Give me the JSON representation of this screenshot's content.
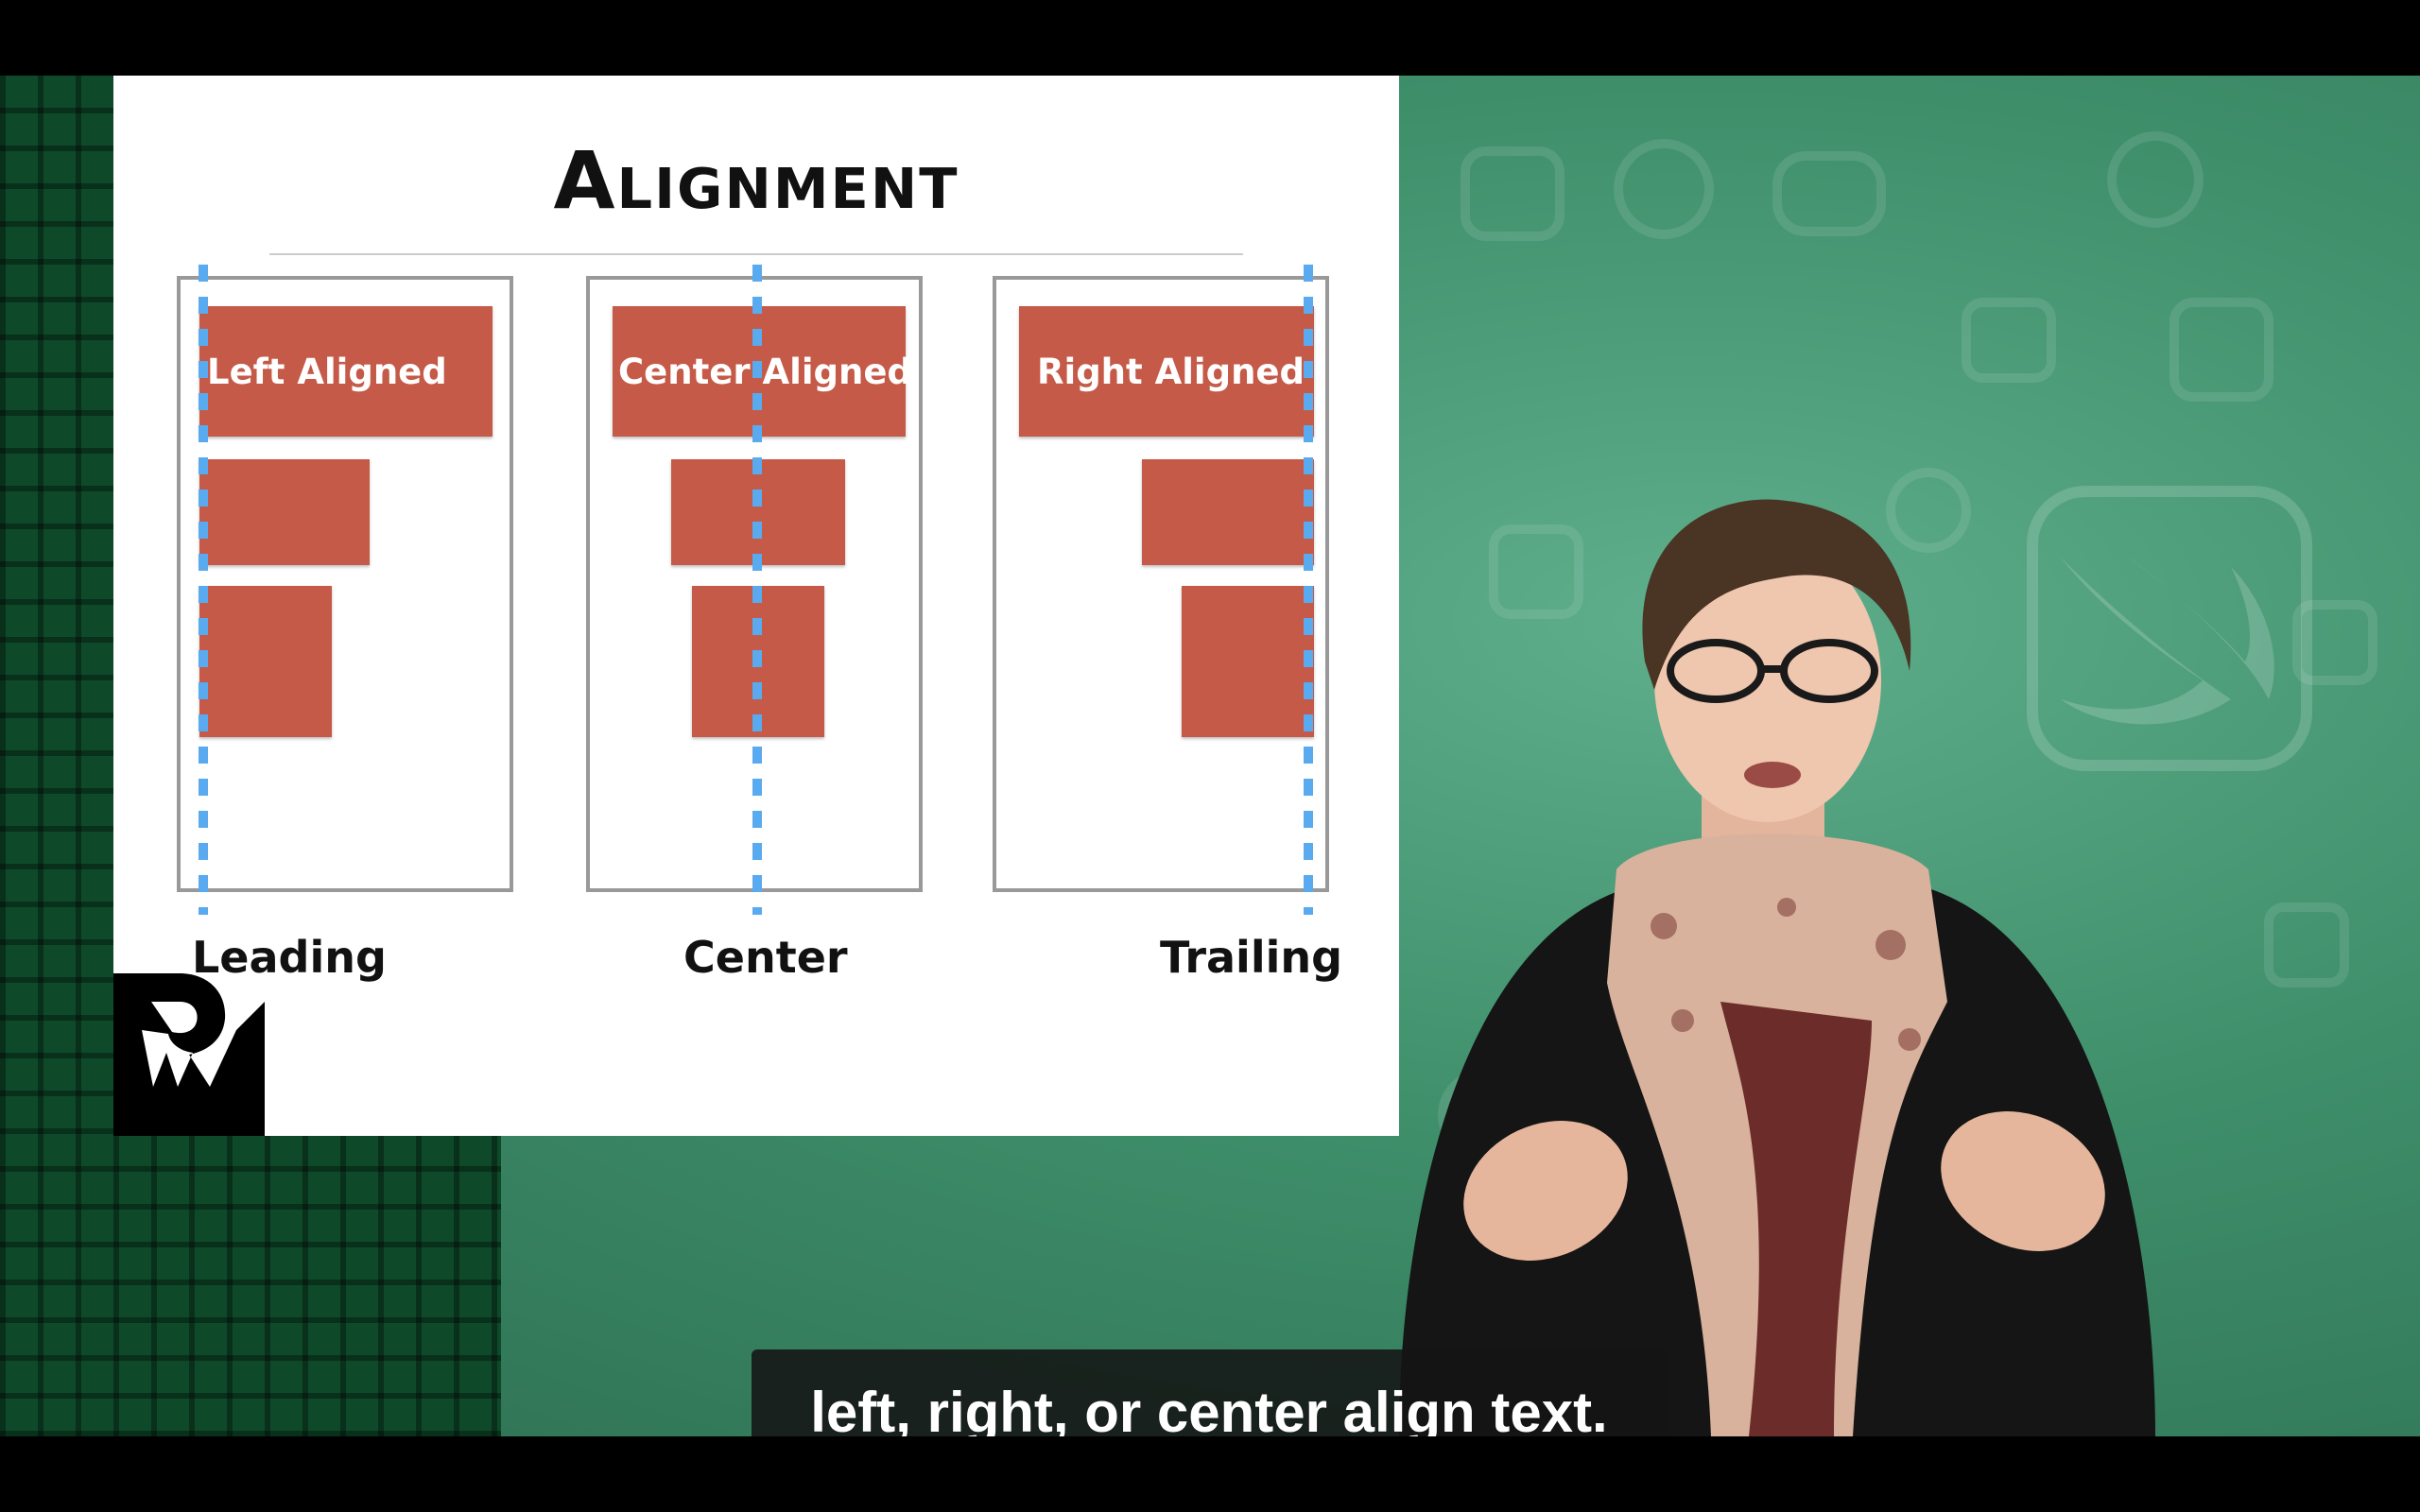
{
  "slide": {
    "title": "Alignment",
    "panels": [
      {
        "block_label": "Left Aligned",
        "caption": "Leading"
      },
      {
        "block_label": "Center Aligned",
        "caption": "Center"
      },
      {
        "block_label": "Right Aligned",
        "caption": "Trailing"
      }
    ],
    "colors": {
      "block": "#c45a47",
      "guide": "#5aaaf0",
      "panel_border": "#999999"
    }
  },
  "logo": {
    "name": "raywenderlich-logo",
    "text": "RW"
  },
  "subtitle": {
    "text": "left, right, or center align text."
  },
  "background": {
    "color": "#3f8f6b",
    "icon": "swift-logo-icon"
  }
}
